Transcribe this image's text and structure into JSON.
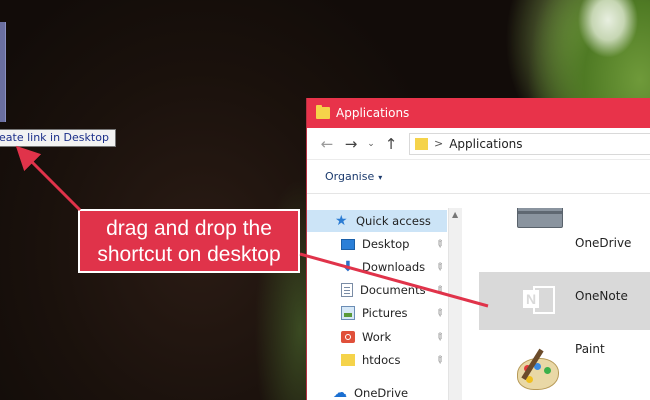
{
  "tooltip": {
    "text": "eate link in Desktop"
  },
  "callout": {
    "line1": "drag and drop the",
    "line2": "shortcut on desktop",
    "color": "#e0334a"
  },
  "window": {
    "title": "Applications",
    "accent": "#e8334a",
    "nav": {
      "back": "←",
      "forward": "→",
      "recent": "⌄",
      "up": "↑"
    },
    "address": {
      "separator": ">",
      "path": "Applications"
    },
    "command": {
      "organise": "Organise",
      "caret": "▾"
    },
    "navpane": {
      "items": [
        {
          "label": "Quick access",
          "icon": "star-icon",
          "glyph": "★"
        },
        {
          "label": "Desktop",
          "icon": "desktop-icon",
          "pinned": true
        },
        {
          "label": "Downloads",
          "icon": "download-icon",
          "glyph": "⬇",
          "pinned": true
        },
        {
          "label": "Documents",
          "icon": "documents-icon",
          "pinned": true
        },
        {
          "label": "Pictures",
          "icon": "pictures-icon",
          "pinned": true
        },
        {
          "label": "Work",
          "icon": "work-icon",
          "pinned": true
        },
        {
          "label": "htdocs",
          "icon": "folder-icon",
          "pinned": true
        },
        {
          "label": "OneDrive",
          "icon": "cloud-icon",
          "glyph": "☁"
        }
      ],
      "pin_glyph": "📌",
      "scroll_up": "▲"
    },
    "apps": [
      {
        "label": "OneDrive",
        "icon": "toolbox-icon"
      },
      {
        "label": "OneNote",
        "icon": "onenote-icon",
        "selected": true,
        "letter": "N"
      },
      {
        "label": "Paint",
        "icon": "paint-icon"
      }
    ]
  }
}
